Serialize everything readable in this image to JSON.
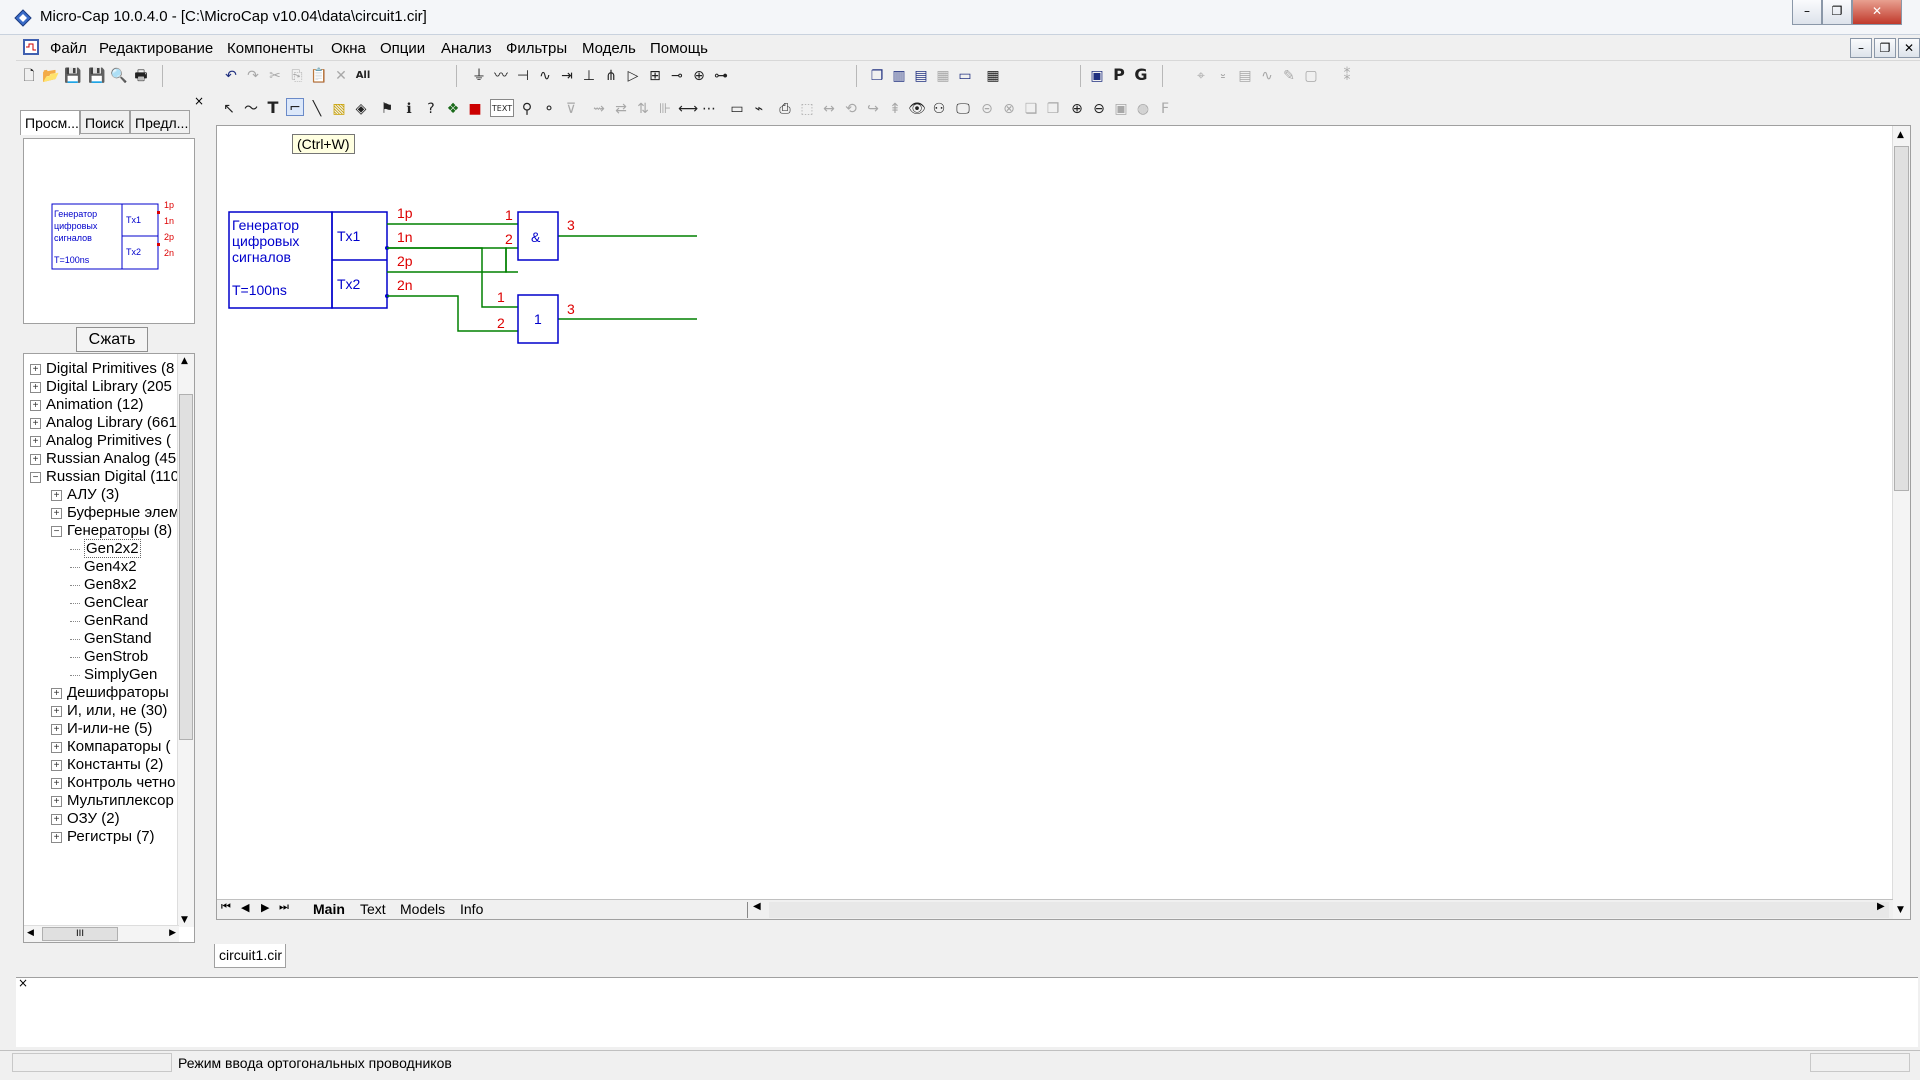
{
  "window": {
    "title": "Micro-Cap 10.0.4.0 - [C:\\MicroCap v10.04\\data\\circuit1.cir]",
    "controls": {
      "minimize": "–",
      "restore": "❐",
      "close": "✕"
    },
    "mdi_controls": {
      "minimize": "–",
      "restore": "❐",
      "close": "✕"
    }
  },
  "menu": [
    "Файл",
    "Редактирование",
    "Компоненты",
    "Окна",
    "Опции",
    "Анализ",
    "Фильтры",
    "Модель",
    "Помощь"
  ],
  "toolbar": {
    "view_buttons": {
      "p": "P",
      "g": "G"
    },
    "text_button": "TEXT"
  },
  "left_panel": {
    "tabs": [
      "Просм...",
      "Поиск",
      "Предл..."
    ],
    "compress_button": "Сжать",
    "tree": [
      {
        "label": "Digital Primitives (8",
        "level": 0,
        "expander": "+"
      },
      {
        "label": "Digital Library (205",
        "level": 0,
        "expander": "+"
      },
      {
        "label": "Animation (12)",
        "level": 0,
        "expander": "+"
      },
      {
        "label": "Analog Library (661",
        "level": 0,
        "expander": "+"
      },
      {
        "label": "Analog Primitives (",
        "level": 0,
        "expander": "+"
      },
      {
        "label": "Russian Analog (45",
        "level": 0,
        "expander": "+"
      },
      {
        "label": "Russian Digital (110",
        "level": 0,
        "expander": "−"
      },
      {
        "label": "АЛУ (3)",
        "level": 1,
        "expander": "+"
      },
      {
        "label": "Буферные элем",
        "level": 1,
        "expander": "+"
      },
      {
        "label": "Генераторы (8)",
        "level": 1,
        "expander": "−"
      },
      {
        "label": "Gen2x2",
        "level": 2,
        "expander": "",
        "selected": true
      },
      {
        "label": "Gen4x2",
        "level": 2,
        "expander": ""
      },
      {
        "label": "Gen8x2",
        "level": 2,
        "expander": ""
      },
      {
        "label": "GenClear",
        "level": 2,
        "expander": ""
      },
      {
        "label": "GenRand",
        "level": 2,
        "expander": ""
      },
      {
        "label": "GenStand",
        "level": 2,
        "expander": ""
      },
      {
        "label": "GenStrob",
        "level": 2,
        "expander": ""
      },
      {
        "label": "SimplyGen",
        "level": 2,
        "expander": ""
      },
      {
        "label": "Дешифраторы",
        "level": 1,
        "expander": "+"
      },
      {
        "label": "И, или, не (30)",
        "level": 1,
        "expander": "+"
      },
      {
        "label": "И-или-не (5)",
        "level": 1,
        "expander": "+"
      },
      {
        "label": "Компараторы (",
        "level": 1,
        "expander": "+"
      },
      {
        "label": "Константы (2)",
        "level": 1,
        "expander": "+"
      },
      {
        "label": "Контроль четно",
        "level": 1,
        "expander": "+"
      },
      {
        "label": "Мультиплексор",
        "level": 1,
        "expander": "+"
      },
      {
        "label": "ОЗУ (2)",
        "level": 1,
        "expander": "+"
      },
      {
        "label": "Регистры (7)",
        "level": 1,
        "expander": "+"
      }
    ],
    "hscroll_thumb": "III"
  },
  "preview": {
    "gen_label": [
      "Генератор",
      "цифровых",
      "сигналов"
    ],
    "period": "T=100ns",
    "ports": [
      "Tx1",
      "Tx2"
    ],
    "pins": [
      "1p",
      "1n",
      "2p",
      "2n"
    ]
  },
  "tooltip": "(Ctrl+W)",
  "schematic": {
    "generator": {
      "label": [
        "Генератор",
        "цифровых",
        "сигналов"
      ],
      "period": "T=100ns",
      "ports": [
        "Tx1",
        "Tx2"
      ],
      "pins": [
        "1p",
        "1n",
        "2p",
        "2n"
      ]
    },
    "gate_and": {
      "symbol": "&",
      "in1": "1",
      "in2": "2",
      "out": "3"
    },
    "gate_or": {
      "symbol": "1",
      "in1": "1",
      "in2": "2",
      "out": "3"
    },
    "colors": {
      "component": "#0000cc",
      "pin_label": "#dd0000",
      "wire": "#008000"
    }
  },
  "sheet_tabs": [
    "Main",
    "Text",
    "Models",
    "Info"
  ],
  "active_sheet": "Main",
  "file_tab": "circuit1.cir",
  "status": "Режим ввода ортогональных проводников"
}
